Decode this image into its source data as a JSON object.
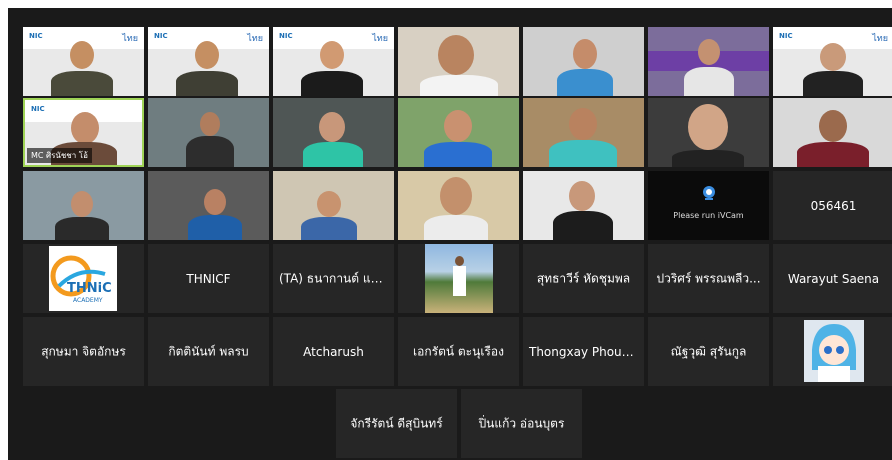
{
  "meeting": {
    "highlight_color": "#9fd356",
    "background_color": "#1a1a1a",
    "tile_color": "#262626"
  },
  "row1": [
    {
      "type": "video",
      "logo_left": "NIC",
      "logo_right": "ไทย"
    },
    {
      "type": "video",
      "logo_left": "NIC",
      "logo_right": "ไทย"
    },
    {
      "type": "video",
      "logo_left": "NIC",
      "logo_right": "ไทย"
    },
    {
      "type": "video"
    },
    {
      "type": "video"
    },
    {
      "type": "video"
    },
    {
      "type": "video",
      "logo_left": "NIC",
      "logo_right": "ไทย"
    }
  ],
  "row2": [
    {
      "type": "video",
      "active": true,
      "name_tag": "MC ศิรนัชชา โอ้",
      "logo_left": "NIC",
      "logo_right": "ไทย"
    },
    {
      "type": "video"
    },
    {
      "type": "video"
    },
    {
      "type": "video"
    },
    {
      "type": "video"
    },
    {
      "type": "video"
    },
    {
      "type": "video"
    }
  ],
  "row3": {
    "icam_text": "Please run iVCam",
    "number_label": "056461"
  },
  "row4": {
    "logo_text": "THNiC",
    "logo_subtext": "ACADEMY",
    "names": [
      "THNICF",
      "(TA) ธนากานต์ แก้...",
      "สุทธาวีร์ หัดชุมพล",
      "ปวริศร์ พรรณพลีว...",
      "Warayut Saena"
    ]
  },
  "row5": {
    "names": [
      "สุกษมา จิตอักษร",
      "กิตตินันท์ พลรบ",
      "Atcharush",
      "เอกรัตน์ ตะนุเรือง",
      "Thongxay Phouth...",
      "ณัฐวุฒิ สุรันกูล"
    ]
  },
  "row6": {
    "names": [
      "จักรีรัตน์ ดีสุบินทร์",
      "ปิ่นแก้ว อ่อนบุตร"
    ]
  },
  "icons": {
    "camera": "camera-icon",
    "anime_avatar": "anime-avatar-icon",
    "thnic_logo": "thnic-logo-icon"
  }
}
